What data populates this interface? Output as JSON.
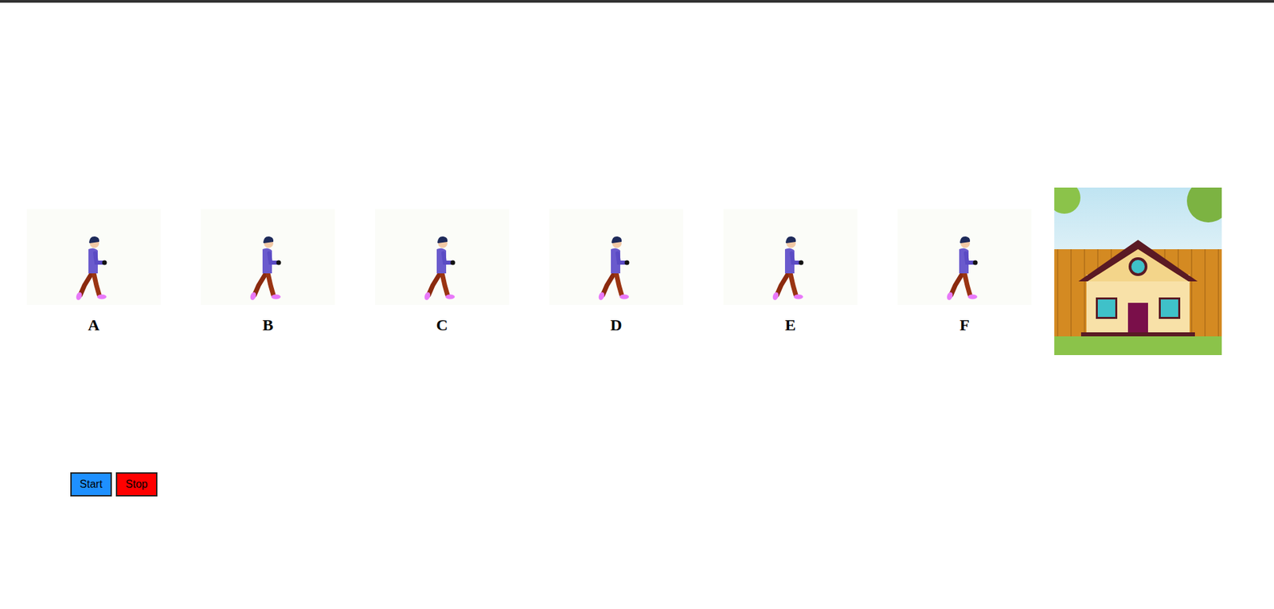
{
  "runners": [
    {
      "label": "A"
    },
    {
      "label": "B"
    },
    {
      "label": "C"
    },
    {
      "label": "D"
    },
    {
      "label": "E"
    },
    {
      "label": "F"
    }
  ],
  "controls": [
    {
      "label": "Start",
      "color": "#1e90ff"
    },
    {
      "label": "Stop",
      "color": "#ff0000"
    }
  ]
}
